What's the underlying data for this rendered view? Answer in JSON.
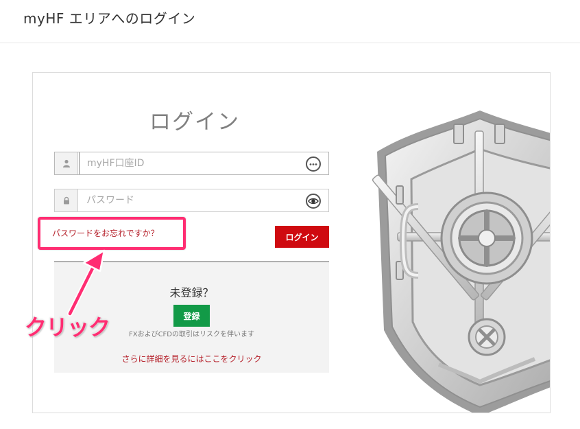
{
  "header": {
    "title": "myHF エリアへのログイン"
  },
  "login": {
    "title": "ログイン",
    "account_id_placeholder": "myHF口座ID",
    "account_id_value": "",
    "password_placeholder": "パスワード",
    "password_value": "",
    "forgot_password_label": "パスワードをお忘れですか？",
    "login_button_label": "ログイン"
  },
  "register": {
    "heading": "未登録？",
    "button_label": "登録",
    "risk_note": "FXおよびCFDの取引はリスクを伴います",
    "details_link": "さらに詳細を見るにはここをクリック"
  },
  "annotation": {
    "label": "クリック",
    "color": "#ff2d72"
  },
  "colors": {
    "login_button": "#cf0a10",
    "register_button": "#129a47",
    "link": "#b5202a",
    "highlight": "#ff2d72"
  },
  "icons": {
    "account_field": "user-icon",
    "password_field": "lock-icon",
    "account_action": "eye-closed-icon",
    "password_action": "eye-icon"
  }
}
